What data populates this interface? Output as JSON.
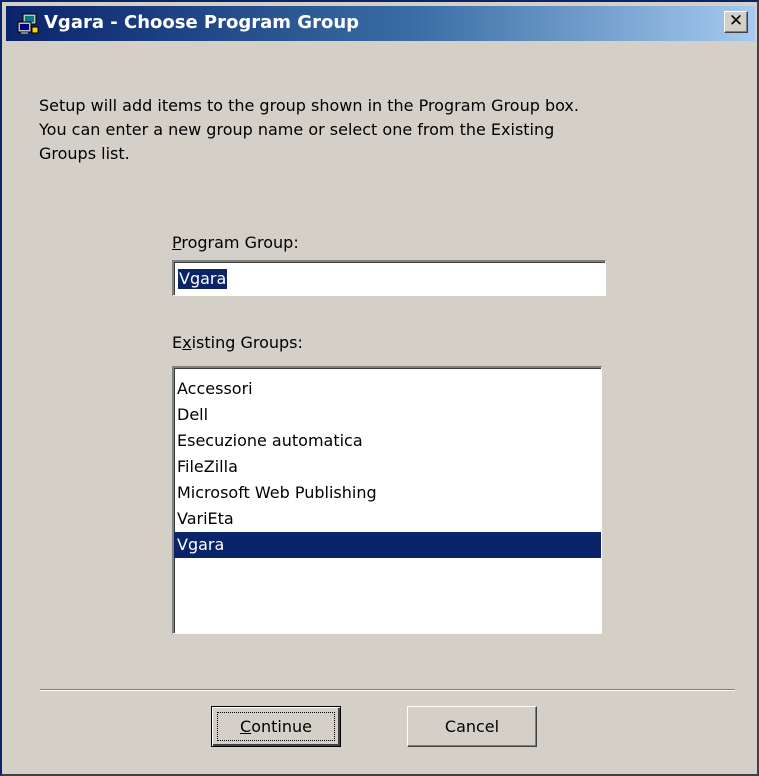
{
  "window": {
    "title": "Vgara - Choose Program Group",
    "close_glyph": "✕",
    "close_icon": "close-icon",
    "title_icon": "setup-computer-icon"
  },
  "intro": {
    "text": "Setup will add items to the group shown in the Program Group box.\nYou can enter a new group name or select one from the Existing\nGroups list."
  },
  "program_group": {
    "label_accel": "P",
    "label_rest": "rogram Group:",
    "value": "Vgara"
  },
  "existing_groups": {
    "label_pre": "E",
    "label_accel": "x",
    "label_rest": "isting Groups:",
    "items": [
      {
        "label": "Accessori",
        "selected": false
      },
      {
        "label": "Dell",
        "selected": false
      },
      {
        "label": "Esecuzione automatica",
        "selected": false
      },
      {
        "label": "FileZilla",
        "selected": false
      },
      {
        "label": "Microsoft Web Publishing",
        "selected": false
      },
      {
        "label": "VariEta",
        "selected": false
      },
      {
        "label": "Vgara",
        "selected": true
      }
    ]
  },
  "buttons": {
    "continue_accel": "C",
    "continue_rest": "ontinue",
    "cancel": "Cancel"
  },
  "colors": {
    "title_bar_start": "#0a246a",
    "title_bar_end": "#a6caf0",
    "selection": "#0a246a",
    "face": "#d4d0c8"
  }
}
